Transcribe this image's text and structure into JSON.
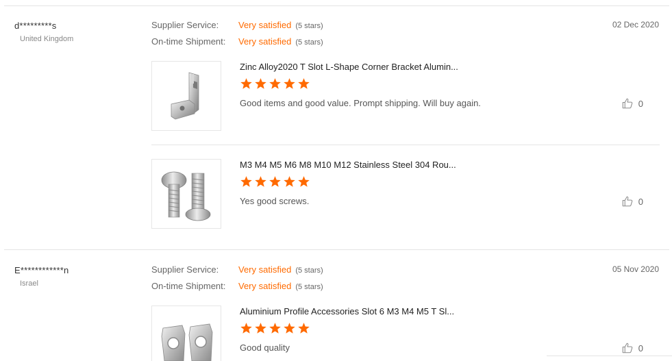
{
  "colors": {
    "accent": "#ff6a00",
    "text": "#333333",
    "muted": "#888888",
    "border": "#e4e4e4"
  },
  "reviews": [
    {
      "buyer": "d*********s",
      "country": "United Kingdom",
      "date": "02 Dec 2020",
      "supplier_service": {
        "label": "Supplier Service:",
        "value": "Very satisfied",
        "note": "(5 stars)"
      },
      "shipment": {
        "label": "On-time Shipment:",
        "value": "Very satisfied",
        "note": "(5 stars)"
      },
      "products": [
        {
          "title": "Zinc Alloy2020 T Slot L-Shape Corner Bracket Alumin...",
          "rating": 5,
          "comment": "Good items and good value. Prompt shipping. Will buy again.",
          "likes": "0",
          "thumb_icon": "corner-bracket-image"
        },
        {
          "title": "M3 M4 M5 M6 M8 M10 M12 Stainless Steel 304 Rou...",
          "rating": 5,
          "comment": "Yes good screws.",
          "likes": "0",
          "thumb_icon": "screws-image"
        }
      ]
    },
    {
      "buyer": "E************n",
      "country": "Israel",
      "date": "05 Nov 2020",
      "supplier_service": {
        "label": "Supplier Service:",
        "value": "Very satisfied",
        "note": "(5 stars)"
      },
      "shipment": {
        "label": "On-time Shipment:",
        "value": "Very satisfied",
        "note": "(5 stars)"
      },
      "products": [
        {
          "title": "Aluminium Profile Accessories Slot 6 M3 M4 M5 T Sl...",
          "rating": 5,
          "comment": "Good quality",
          "likes": "0",
          "thumb_icon": "t-nut-image"
        }
      ]
    }
  ]
}
